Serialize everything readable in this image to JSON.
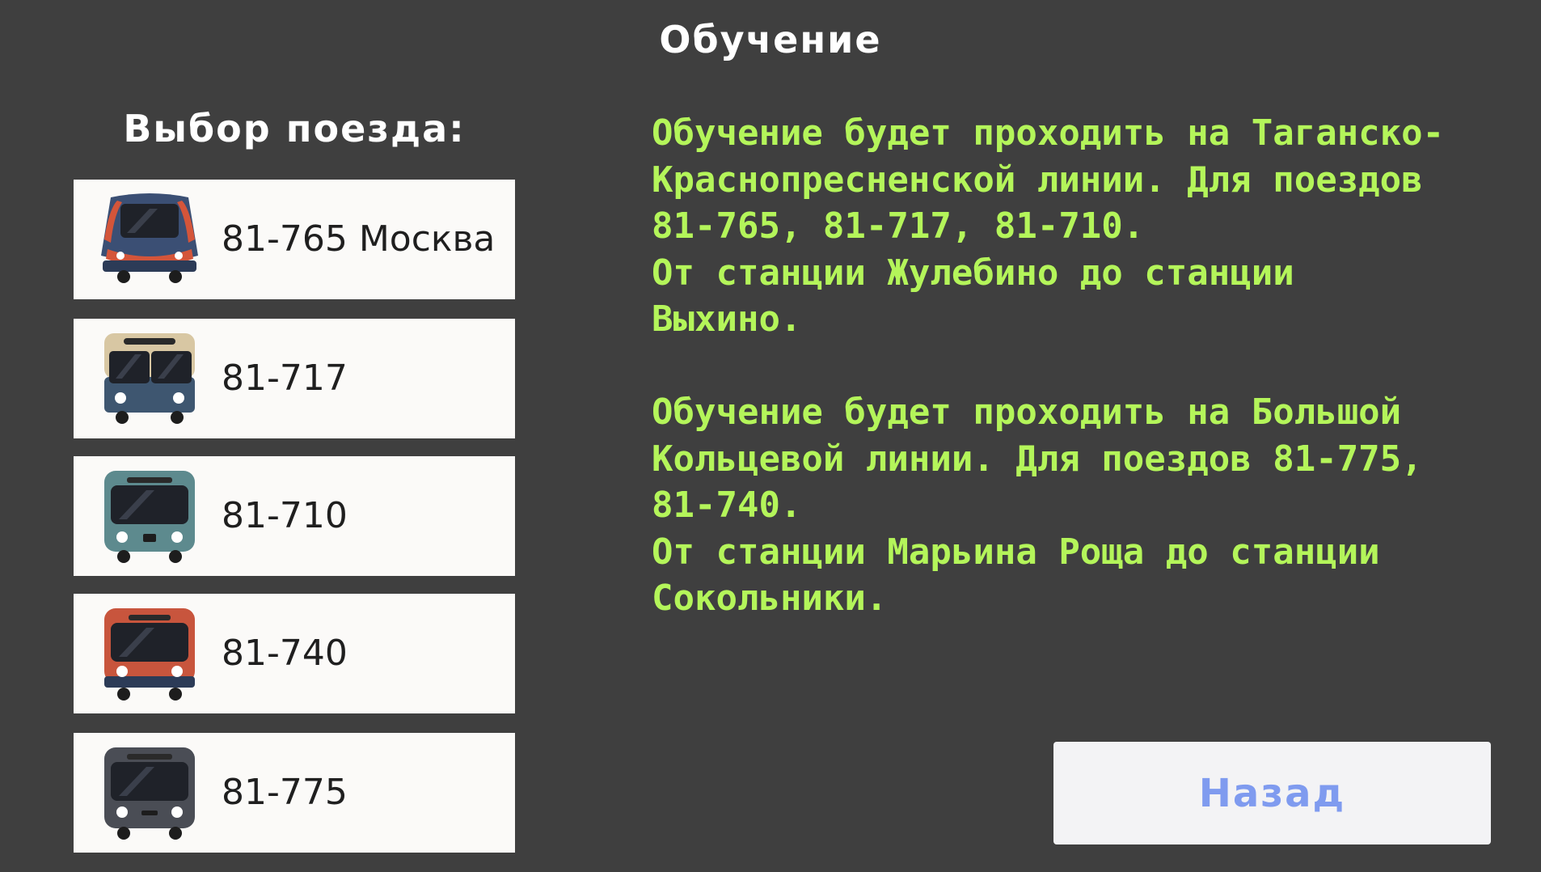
{
  "header": {
    "title": "Обучение"
  },
  "train_select": {
    "heading": "Выбор поезда:",
    "items": [
      {
        "label": "81-765 Москва",
        "icon": "train-81-765-icon",
        "color": "#3b4f74"
      },
      {
        "label": "81-717",
        "icon": "train-81-717-icon",
        "color": "#3e5670"
      },
      {
        "label": "81-710",
        "icon": "train-81-710-icon",
        "color": "#5d8a8e"
      },
      {
        "label": "81-740",
        "icon": "train-81-740-icon",
        "color": "#c8553d"
      },
      {
        "label": "81-775",
        "icon": "train-81-775-icon",
        "color": "#4a4d55"
      }
    ]
  },
  "info": {
    "paragraphs": [
      "Обучение будет проходить на Таганско-\nКраснопресненской линии. Для поездов\n81-765, 81-717, 81-710.\nОт станции Жулебино до станции\nВыхино.",
      "Обучение будет проходить на Большой\nКольцевой линии. Для поездов 81-775,\n81-740.\nОт станции Марьина Роща до станции\nСокольники."
    ],
    "color": "#b4f55a"
  },
  "footer": {
    "back_label": "Назад",
    "back_color": "#7f9bef"
  }
}
